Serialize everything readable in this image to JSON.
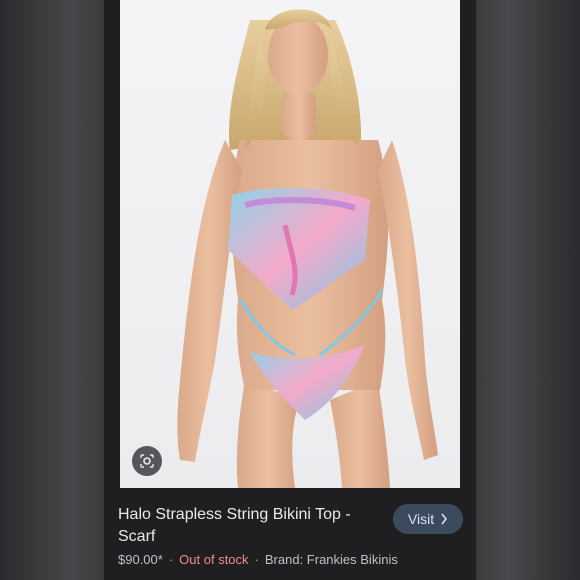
{
  "product": {
    "title": "Halo Strapless String Bikini Top - Scarf",
    "price": "$90.00*",
    "stock_status": "Out of stock",
    "brand": "Brand: Frankies Bikinis",
    "separator": "·"
  },
  "actions": {
    "visit_label": "Visit",
    "visit_icon": "chevron-right-icon",
    "lens_icon": "lens-search-icon"
  },
  "colors": {
    "card_bg": "#1f1f22",
    "visit_bg": "#3c4a5e",
    "visit_text": "#d2e3fc",
    "stock_text": "#f28b82"
  }
}
